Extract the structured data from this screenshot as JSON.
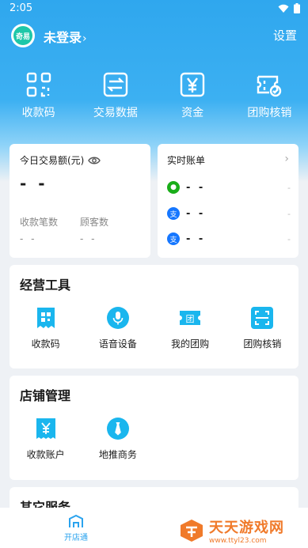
{
  "status_bar": {
    "time": "2:05"
  },
  "header": {
    "avatar_text": "奇易",
    "login_label": "未登录",
    "login_chevron": "›",
    "settings_label": "设置"
  },
  "quick_actions": [
    {
      "label": "收款码",
      "icon": "qr-code-icon"
    },
    {
      "label": "交易数据",
      "icon": "transfer-icon"
    },
    {
      "label": "资金",
      "icon": "yuan-icon"
    },
    {
      "label": "团购核销",
      "icon": "ticket-check-icon"
    }
  ],
  "trade": {
    "title": "今日交易额(元)",
    "amount": "- -",
    "count_label": "收款笔数",
    "count_value": "- -",
    "customer_label": "顾客数",
    "customer_value": "- -"
  },
  "bill": {
    "title": "实时账单",
    "rows": [
      {
        "amount": "- -",
        "dash": "-",
        "icon": "wechat-pay-icon",
        "color": "#1aad19"
      },
      {
        "amount": "- -",
        "dash": "-",
        "icon": "alipay-icon",
        "color": "#1677ff"
      },
      {
        "amount": "- -",
        "dash": "-",
        "icon": "alipay-icon",
        "color": "#1677ff"
      }
    ]
  },
  "tools": {
    "title": "经营工具",
    "items": [
      {
        "label": "收款码",
        "icon": "qr-code-icon"
      },
      {
        "label": "语音设备",
        "icon": "microphone-icon"
      },
      {
        "label": "我的团购",
        "icon": "group-buy-icon"
      },
      {
        "label": "团购核销",
        "icon": "scan-icon"
      }
    ]
  },
  "store": {
    "title": "店铺管理",
    "items": [
      {
        "label": "收款账户",
        "icon": "yuan-account-icon"
      },
      {
        "label": "地推商务",
        "icon": "tie-icon"
      }
    ]
  },
  "other": {
    "title": "其它服务"
  },
  "tabbar": {
    "tab_label": "开店通",
    "icon": "shop-icon"
  },
  "watermark": {
    "title": "天天游戏网",
    "url": "www.ttyl23.com"
  },
  "colors": {
    "primary": "#2aa3ee",
    "accent": "#1ab6ee",
    "watermark": "#f07a2a"
  }
}
